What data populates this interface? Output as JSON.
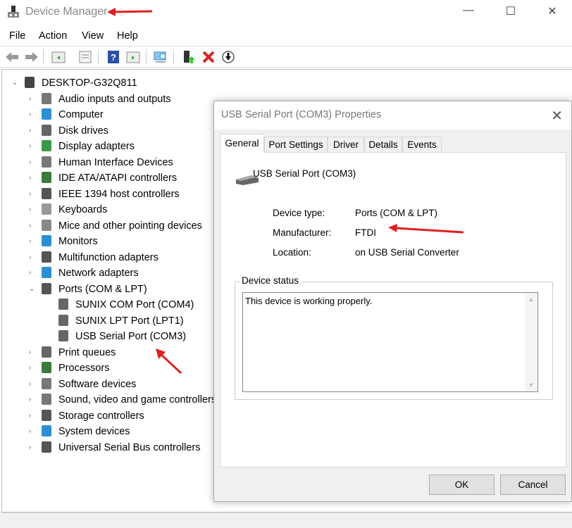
{
  "window": {
    "title": "Device Manager",
    "controls": {
      "minimize": "—",
      "maximize": "☐",
      "close": "✕"
    }
  },
  "menu": [
    "File",
    "Action",
    "View",
    "Help"
  ],
  "toolbar": [
    "back-icon",
    "forward-icon",
    "show-hide-console-tree-icon",
    "properties-icon",
    "help-icon",
    "action-pane-icon",
    "scan-hardware-icon",
    "update-driver-icon",
    "uninstall-icon",
    "disable-icon"
  ],
  "tree": {
    "root": "DESKTOP-G32Q811",
    "items": [
      {
        "label": "Audio inputs and outputs",
        "icon": "speaker-icon",
        "color": "#777"
      },
      {
        "label": "Computer",
        "icon": "monitor-icon",
        "color": "#2b8fd6"
      },
      {
        "label": "Disk drives",
        "icon": "disk-icon",
        "color": "#666"
      },
      {
        "label": "Display adapters",
        "icon": "display-adapter-icon",
        "color": "#3a9a4a"
      },
      {
        "label": "Human Interface Devices",
        "icon": "hid-icon",
        "color": "#777"
      },
      {
        "label": "IDE ATA/ATAPI controllers",
        "icon": "ide-icon",
        "color": "#3a7a3a"
      },
      {
        "label": "IEEE 1394 host controllers",
        "icon": "ieee-icon",
        "color": "#555"
      },
      {
        "label": "Keyboards",
        "icon": "keyboard-icon",
        "color": "#999"
      },
      {
        "label": "Mice and other pointing devices",
        "icon": "mouse-icon",
        "color": "#888"
      },
      {
        "label": "Monitors",
        "icon": "monitor-icon",
        "color": "#2b8fd6"
      },
      {
        "label": "Multifunction adapters",
        "icon": "multifunction-icon",
        "color": "#555"
      },
      {
        "label": "Network adapters",
        "icon": "network-icon",
        "color": "#2b8fd6"
      },
      {
        "label": "Ports (COM & LPT)",
        "icon": "port-icon",
        "color": "#555",
        "expanded": true,
        "children": [
          "SUNIX COM Port (COM4)",
          "SUNIX LPT Port (LPT1)",
          "USB Serial Port (COM3)"
        ]
      },
      {
        "label": "Print queues",
        "icon": "printer-icon",
        "color": "#666"
      },
      {
        "label": "Processors",
        "icon": "processor-icon",
        "color": "#3a7a3a"
      },
      {
        "label": "Software devices",
        "icon": "software-icon",
        "color": "#777"
      },
      {
        "label": "Sound, video and game controllers",
        "icon": "speaker-icon",
        "color": "#777"
      },
      {
        "label": "Storage controllers",
        "icon": "storage-icon",
        "color": "#555"
      },
      {
        "label": "System devices",
        "icon": "system-icon",
        "color": "#2b8fd6"
      },
      {
        "label": "Universal Serial Bus controllers",
        "icon": "usb-icon",
        "color": "#555"
      }
    ]
  },
  "dialog": {
    "title": "USB Serial Port (COM3) Properties",
    "tabs": [
      "General",
      "Port Settings",
      "Driver",
      "Details",
      "Events"
    ],
    "device_name": "USB Serial Port (COM3)",
    "fields": [
      {
        "label": "Device type:",
        "value": "Ports (COM & LPT)"
      },
      {
        "label": "Manufacturer:",
        "value": "FTDI"
      },
      {
        "label": "Location:",
        "value": "on USB Serial Converter"
      }
    ],
    "status_group": "Device status",
    "status_text": "This device is working properly.",
    "ok": "OK",
    "cancel": "Cancel"
  },
  "annotation_color": "#e02020"
}
